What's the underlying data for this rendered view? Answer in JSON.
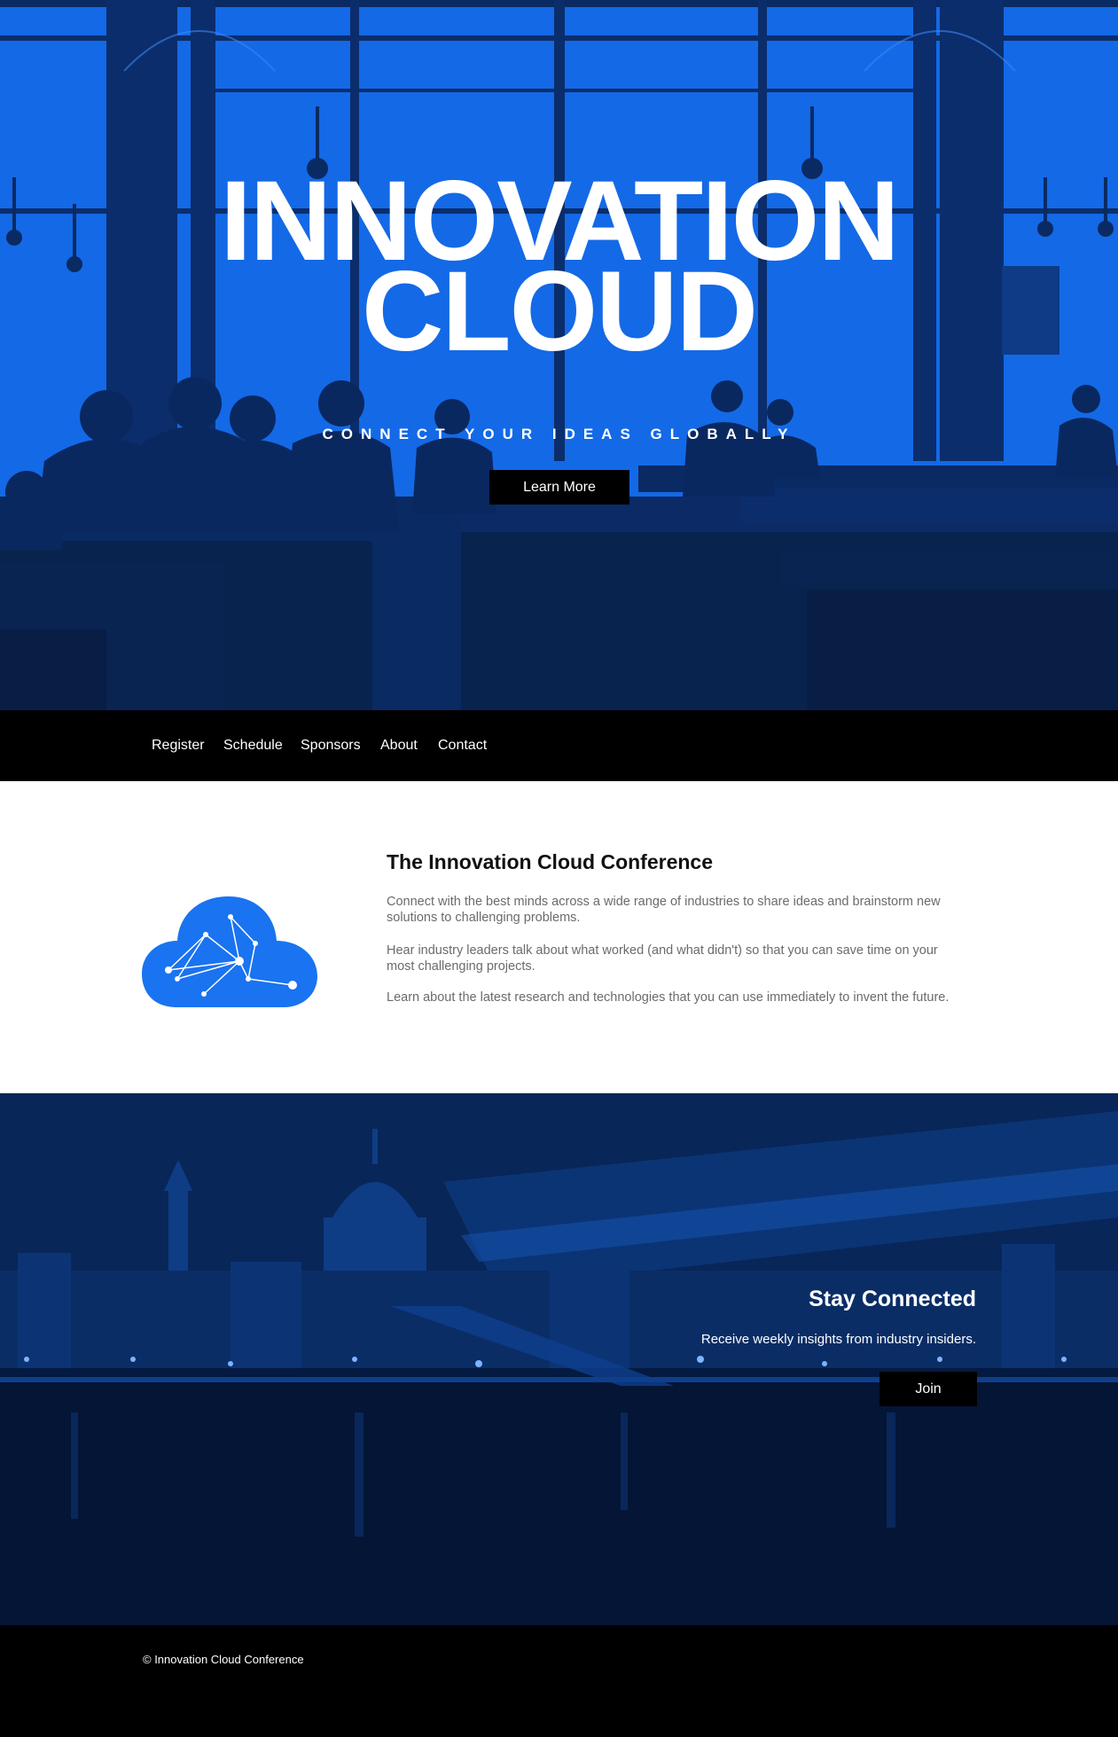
{
  "hero": {
    "title_line1": "INNOVATION",
    "title_line2": "CLOUD",
    "tagline": "CONNECT YOUR IDEAS GLOBALLY",
    "cta_label": "Learn More"
  },
  "nav": {
    "items": [
      "Register",
      "Schedule",
      "Sponsors",
      "About",
      "Contact"
    ]
  },
  "about": {
    "heading": "The Innovation Cloud Conference",
    "paragraphs": [
      "Connect with the best minds across a wide range of industries to share ideas and brainstorm new solutions to challenging problems.",
      "Hear industry leaders talk about what worked (and what didn't) so that you can save time on your most challenging projects.",
      "Learn about the latest research and technologies that you can use immediately to invent the future."
    ],
    "image_icon": "cloud-network-icon"
  },
  "stay_connected": {
    "heading": "Stay Connected",
    "subtext": "Receive weekly insights from industry insiders.",
    "join_label": "Join"
  },
  "footer": {
    "copyright": "© Innovation Cloud Conference"
  },
  "colors": {
    "brand_blue": "#1469e6",
    "dark_navy": "#06204d",
    "black": "#000000",
    "white": "#ffffff"
  }
}
